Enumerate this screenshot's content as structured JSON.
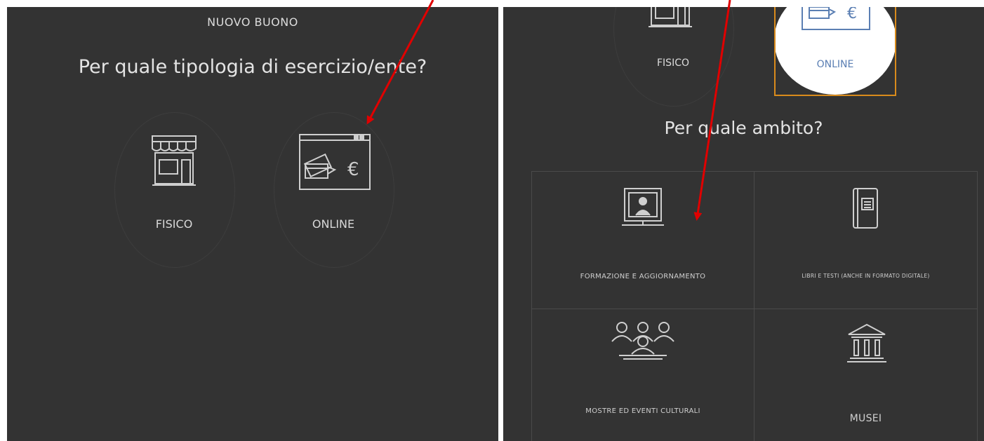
{
  "left": {
    "header": "NUOVO BUONO",
    "question": "Per quale tipologia di esercizio/ente?",
    "options": [
      {
        "label": "FISICO",
        "icon": "storefront-icon"
      },
      {
        "label": "ONLINE",
        "icon": "online-payment-icon"
      }
    ]
  },
  "right": {
    "selected_options": [
      {
        "label": "FISICO",
        "icon": "storefront-icon",
        "selected": false
      },
      {
        "label": "ONLINE",
        "icon": "online-payment-icon",
        "selected": true
      }
    ],
    "question": "Per quale ambito?",
    "categories": [
      {
        "label": "FORMAZIONE E AGGIORNAMENTO",
        "icon": "teacher-monitor-icon"
      },
      {
        "label": "LIBRI E TESTI (ANCHE IN FORMATO DIGITALE)",
        "icon": "book-icon"
      },
      {
        "label": "MOSTRE ED EVENTI CULTURALI",
        "icon": "audience-icon"
      },
      {
        "label": "MUSEI",
        "icon": "museum-icon"
      }
    ]
  },
  "colors": {
    "panel_bg": "#333333",
    "text": "#dcdcdc",
    "selected_border": "#d98b1c",
    "selected_text": "#5b7fb3",
    "arrow": "#e00000"
  }
}
